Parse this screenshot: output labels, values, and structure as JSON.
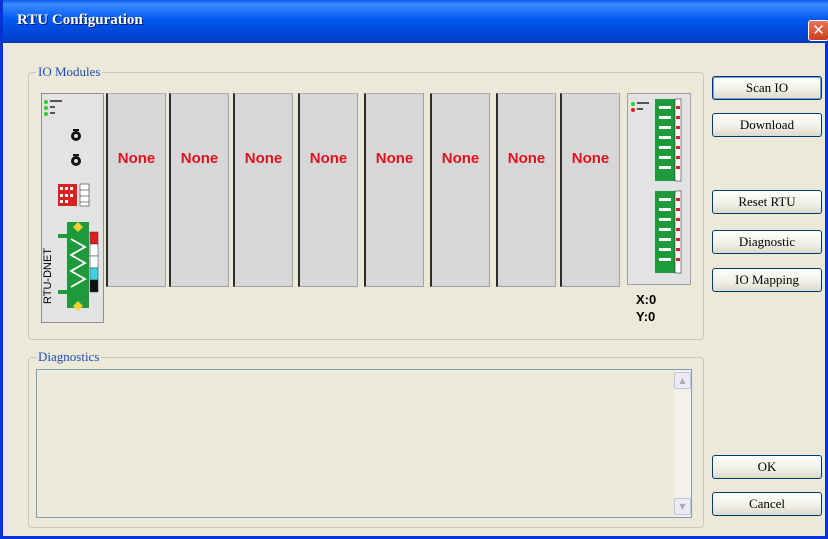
{
  "window": {
    "title": "RTU Configuration",
    "close_glyph": "✕"
  },
  "io_modules": {
    "legend": "IO Modules",
    "main_module": {
      "label": "RTU-DNET",
      "led_labels": [
        "RUN/STOP",
        "MS",
        "NS"
      ],
      "switch_label": "X10",
      "switch_label2": "X1",
      "dip_label": "DIP SW"
    },
    "slots": [
      "None",
      "None",
      "None",
      "None",
      "None",
      "None",
      "None",
      "None"
    ],
    "end_module": {
      "led_labels": [
        "RUN/STOP",
        "LV"
      ]
    },
    "x_count": "X:0",
    "y_count": "Y:0"
  },
  "diagnostics": {
    "legend": "Diagnostics",
    "text": ""
  },
  "buttons": {
    "scan_io": "Scan IO",
    "download": "Download",
    "reset_rtu": "Reset RTU",
    "diagnostic": "Diagnostic",
    "io_mapping": "IO Mapping",
    "ok": "OK",
    "cancel": "Cancel"
  },
  "colors": {
    "title_blue": "#0058EE",
    "none_red": "#E0101E",
    "legend_blue": "#1B4CC4",
    "connector_green": "#1F9A3A"
  }
}
